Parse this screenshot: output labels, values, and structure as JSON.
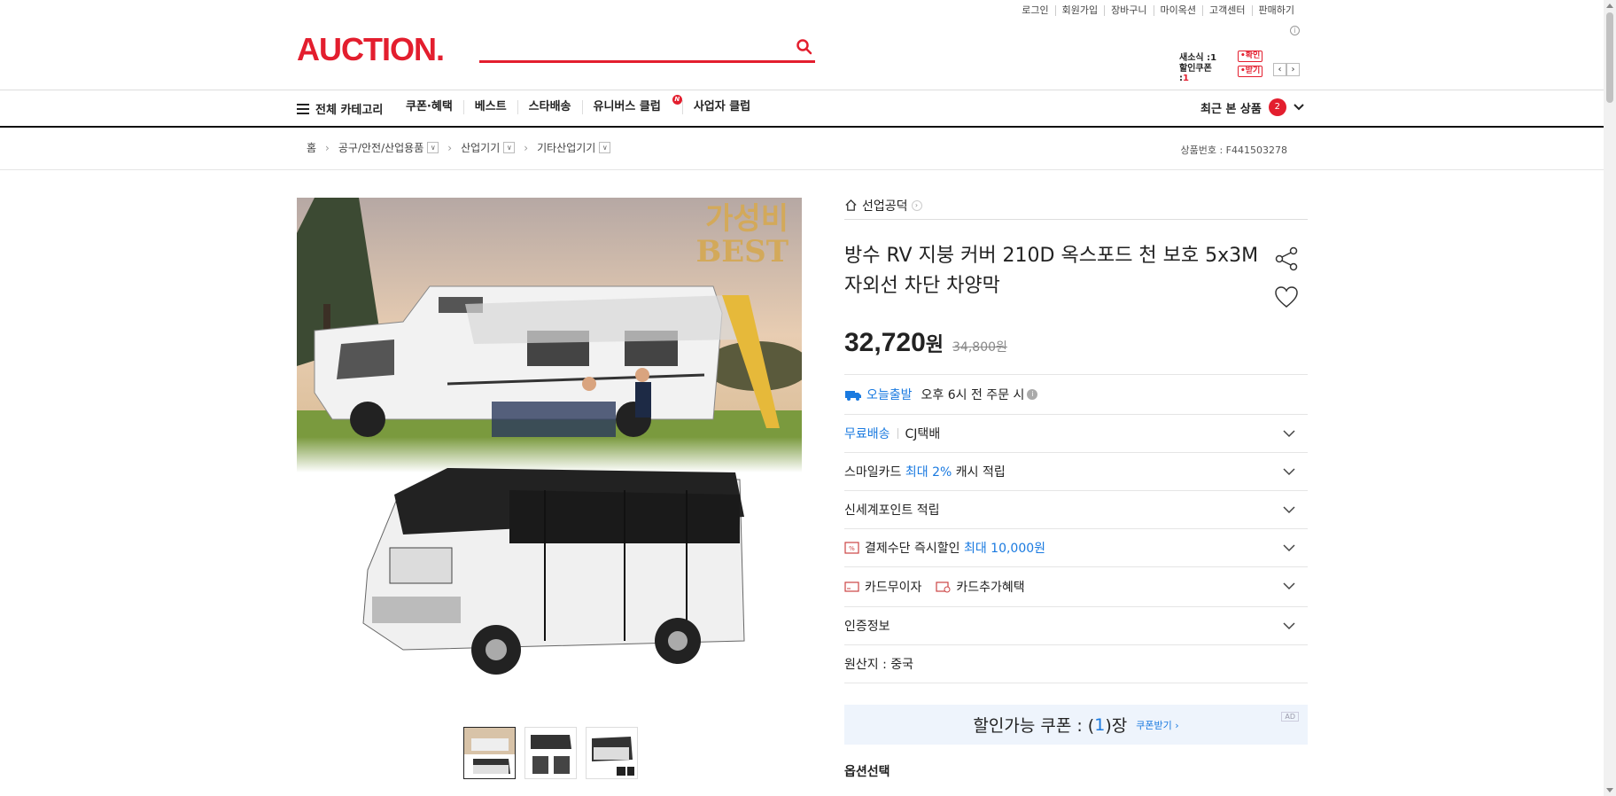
{
  "header": {
    "util_links": [
      "로그인",
      "회원가입",
      "장바구니",
      "마이옥션",
      "고객센터",
      "판매하기"
    ],
    "logo": "AUCTION.",
    "search_placeholder": ""
  },
  "mini_widget": {
    "news_label": "새소식 :",
    "news_count": "1",
    "news_tag": "확인",
    "coupon_label": "할인쿠폰 :",
    "coupon_count": "1",
    "coupon_tag": "받기"
  },
  "gnb": {
    "all_category": "전체 카테고리",
    "menu": [
      "쿠폰·혜택",
      "베스트",
      "스타배송",
      "유니버스 클럽",
      "사업자 클럽"
    ],
    "new_badge": "N",
    "recent_label": "최근 본 상품",
    "recent_count": "2"
  },
  "breadcrumb": {
    "home": "홈",
    "items": [
      "공구/안전/산업용품",
      "산업기기",
      "기타산업기기"
    ],
    "product_number": "상품번호 : F441503278"
  },
  "product": {
    "seller": "선업공덕",
    "title": "방수 RV 지붕 커버 210D 옥스포드 천 보호 5x3M 자외선 차단 차양막",
    "price": "32,720",
    "currency": "원",
    "original_price": "34,800원",
    "image_text_line1": "가성비",
    "image_text_line2": "BEST"
  },
  "rows": {
    "today_label": "오늘출발",
    "today_desc": "오후 6시 전 주문 시",
    "shipping_free": "무료배송",
    "shipping_courier": "CJ택배",
    "smile_prefix": "스마일카드",
    "smile_highlight": "최대 2%",
    "smile_suffix": "캐시 적립",
    "shinsegae": "신세계포인트 적립",
    "pay_prefix": "결제수단 즉시할인",
    "pay_highlight": "최대 10,000원",
    "card_interest": "카드무이자",
    "card_extra": "카드추가혜택",
    "cert": "인증정보",
    "origin": "원산지 : 중국"
  },
  "coupon": {
    "label": "할인가능 쿠폰 : (",
    "count": "1",
    "suffix": ")장",
    "get": "쿠폰받기 ›",
    "ad": "AD"
  },
  "options": {
    "title": "옵션선택"
  },
  "colors": {
    "brand": "#e31e2e",
    "accent_blue": "#1a7ae0"
  }
}
